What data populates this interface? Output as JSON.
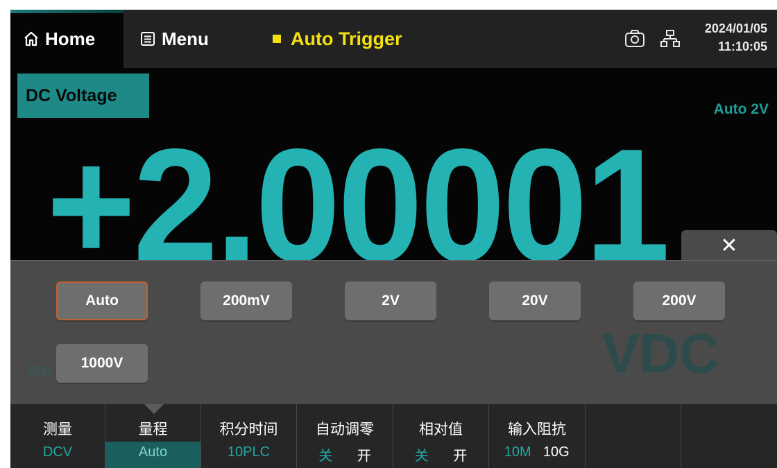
{
  "topbar": {
    "home_label": "Home",
    "menu_label": "Menu",
    "trigger_label": "Auto Trigger",
    "date": "2024/01/05",
    "time": "11:10:05"
  },
  "measurement": {
    "mode": "DC Voltage",
    "range_indicator": "Auto 2V",
    "reading": "+2.00001",
    "unit": "VDC",
    "input_label_partial": "Inp"
  },
  "range_popup": {
    "close_label": "✕",
    "options": [
      "Auto",
      "200mV",
      "2V",
      "20V",
      "200V",
      "1000V"
    ],
    "selected": "Auto"
  },
  "softkeys": [
    {
      "label": "测量",
      "value": "DCV"
    },
    {
      "label": "量程",
      "value": "Auto"
    },
    {
      "label": "积分时间",
      "value": "10PLC"
    },
    {
      "label": "自动调零",
      "off": "关",
      "on": "开"
    },
    {
      "label": "相对值",
      "off": "关",
      "on": "开"
    },
    {
      "label": "输入阻抗",
      "a": "10M",
      "b": "10G"
    }
  ],
  "colors": {
    "accent": "#22a7a4",
    "trigger": "#f4e010",
    "background": "#050505",
    "selected_border": "#c0622a"
  },
  "icons": [
    "home-icon",
    "menu-icon",
    "camera-icon",
    "network-icon",
    "close-icon"
  ]
}
